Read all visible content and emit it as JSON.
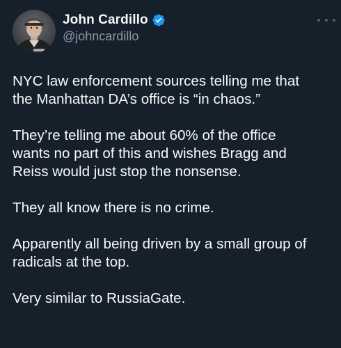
{
  "author": {
    "display_name": "John Cardillo",
    "handle": "@johncardillo",
    "verified": true,
    "verified_color": "#1d9bf0"
  },
  "icons": {
    "avatar": "avatar-photo",
    "verified": "verified-badge-icon",
    "more": "more-options-icon"
  },
  "tweet": {
    "paragraphs": [
      {
        "lines": [
          "NYC law enforcement sources telling me that",
          "the Manhattan DA’s office is “in chaos.”"
        ]
      },
      {
        "lines": [
          "They’re telling me about 60% of the office",
          "wants no part of this and wishes Bragg and",
          "Reiss would just stop the nonsense."
        ]
      },
      {
        "lines": [
          "They all know there is no crime."
        ]
      },
      {
        "lines": [
          "Apparently all being driven by a small group of",
          "radicals at the top."
        ]
      },
      {
        "lines": [
          "Very similar to RussiaGate."
        ]
      }
    ]
  },
  "colors": {
    "background": "#15202b",
    "text": "#f7f9f9",
    "secondary_text": "#8b98a5"
  }
}
